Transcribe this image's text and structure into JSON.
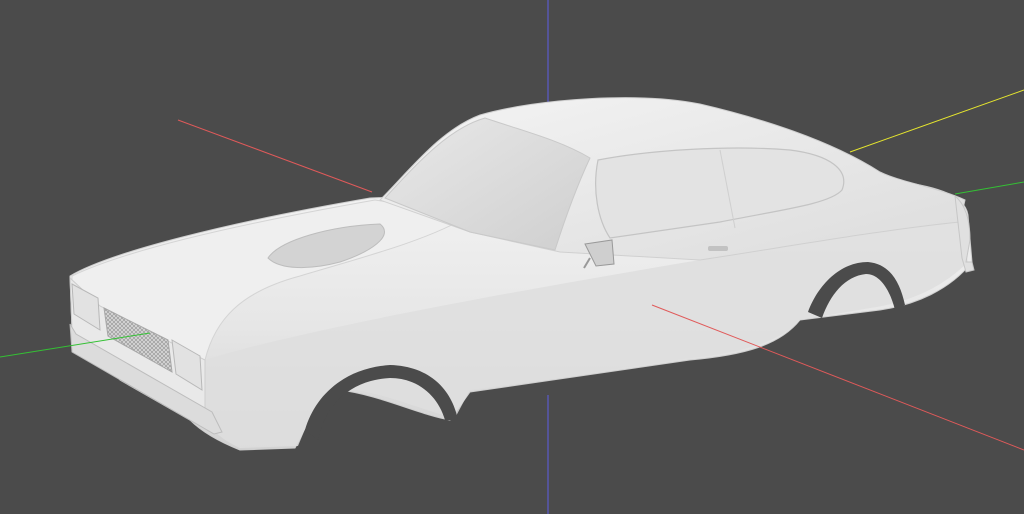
{
  "viewport": {
    "background_color": "#4b4b4b",
    "model_color": "#ececec",
    "axes": {
      "x_color": "#e05a5a",
      "y_color": "#34c134",
      "z_color": "#5c5ce6",
      "extra_color": "#e6e62e"
    },
    "model_name": "car-body-model"
  }
}
